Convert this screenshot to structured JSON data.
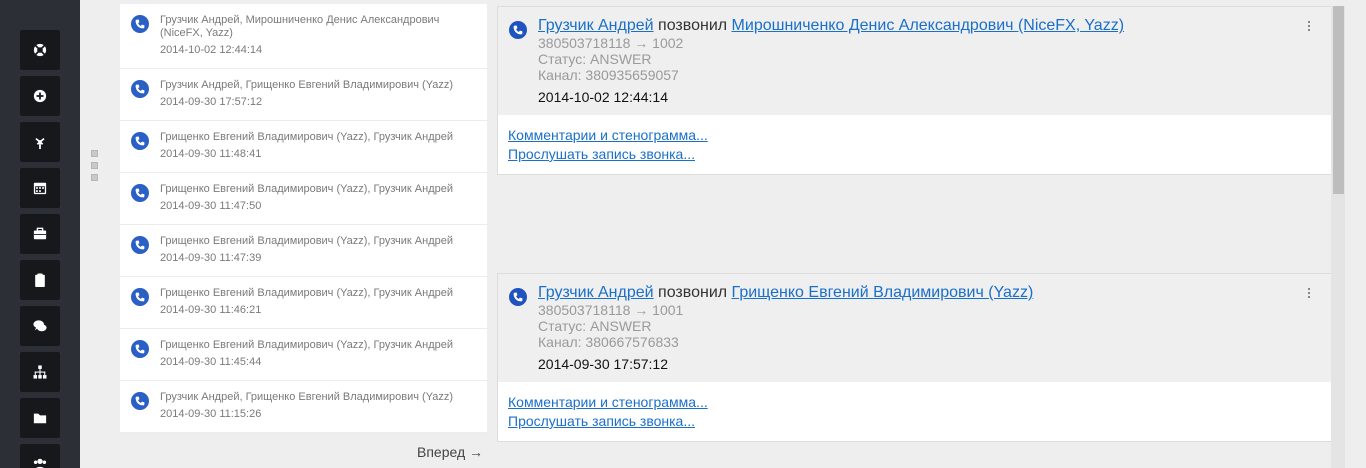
{
  "rail": {
    "items": [
      {
        "name": "lifebuoy-icon"
      },
      {
        "name": "add-circle-icon"
      },
      {
        "name": "fork-icon"
      },
      {
        "name": "calendar-icon"
      },
      {
        "name": "briefcase-icon"
      },
      {
        "name": "clipboard-icon"
      },
      {
        "name": "chat-icon"
      },
      {
        "name": "sitemap-icon"
      },
      {
        "name": "folder-icon"
      },
      {
        "name": "users-icon"
      }
    ]
  },
  "calls": [
    {
      "title": "Грузчик Андрей, Мирошниченко Денис Александрович (NiceFX, Yazz)",
      "time": "2014-10-02 12:44:14"
    },
    {
      "title": "Грузчик Андрей, Грищенко Евгений Владимирович (Yazz)",
      "time": "2014-09-30 17:57:12"
    },
    {
      "title": "Грищенко Евгений Владимирович (Yazz), Грузчик Андрей",
      "time": "2014-09-30 11:48:41"
    },
    {
      "title": "Грищенко Евгений Владимирович (Yazz), Грузчик Андрей",
      "time": "2014-09-30 11:47:50"
    },
    {
      "title": "Грищенко Евгений Владимирович (Yazz), Грузчик Андрей",
      "time": "2014-09-30 11:47:39"
    },
    {
      "title": "Грищенко Евгений Владимирович (Yazz), Грузчик Андрей",
      "time": "2014-09-30 11:46:21"
    },
    {
      "title": "Грищенко Евгений Владимирович (Yazz), Грузчик Андрей",
      "time": "2014-09-30 11:45:44"
    },
    {
      "title": "Грузчик Андрей, Грищенко Евгений Владимирович (Yazz)",
      "time": "2014-09-30 11:15:26"
    }
  ],
  "pagination": {
    "next_label": "Вперед →"
  },
  "details": [
    {
      "caller": "Грузчик Андрей",
      "verb": "позвонил",
      "callee": "Мирошниченко Денис Александрович (NiceFX, Yazz)",
      "numbers": "380503718118 → 1002",
      "status": "Статус: ANSWER",
      "channel": "Канал: 380935659057",
      "time": "2014-10-02 12:44:14",
      "comments_link": "Комментарии и стенограмма...",
      "listen_link": "Прослушать запись звонка..."
    },
    {
      "caller": "Грузчик Андрей",
      "verb": "позвонил",
      "callee": "Грищенко Евгений Владимирович (Yazz)",
      "numbers": "380503718118 → 1001",
      "status": "Статус: ANSWER",
      "channel": "Канал: 380667576833",
      "time": "2014-09-30 17:57:12",
      "comments_link": "Комментарии и стенограмма...",
      "listen_link": "Прослушать запись звонка..."
    }
  ],
  "colors": {
    "accent": "#1a6fc9",
    "phone_badge": "#1f54c0",
    "rail": "#2c2f35"
  }
}
